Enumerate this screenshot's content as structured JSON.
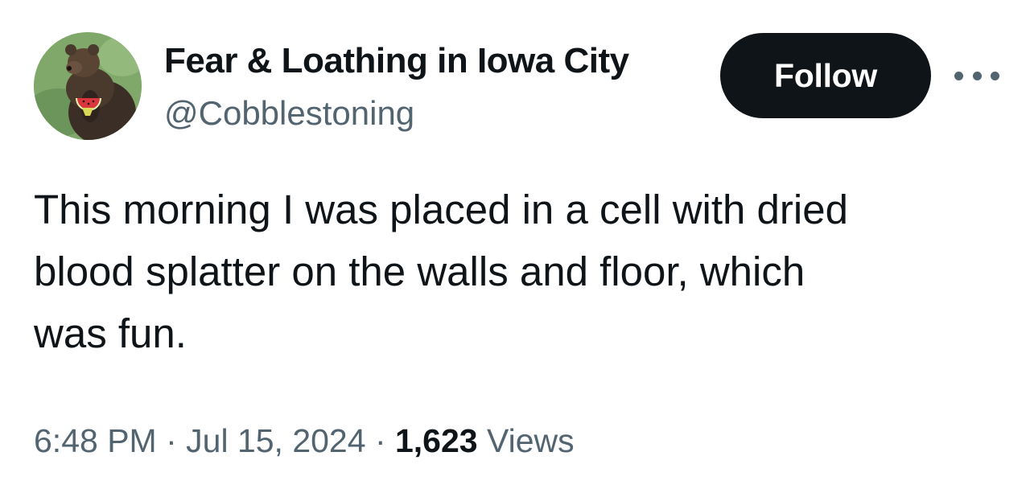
{
  "author": {
    "display_name": "Fear & Loathing in Iowa City",
    "handle": "@Cobblestoning",
    "avatar_icon": "bear-with-watermelon-avatar"
  },
  "actions": {
    "follow_label": "Follow",
    "more_icon": "more-horizontal-icon"
  },
  "tweet": {
    "text": "This morning I was placed in a cell with dried\nblood splatter on the walls and floor, which\nwas fun.",
    "time": "6:48 PM",
    "separator": " · ",
    "date": "Jul 15, 2024",
    "views_count": "1,623",
    "views_label": " Views"
  },
  "colors": {
    "text_primary": "#0f1419",
    "text_secondary": "#536471",
    "button_bg": "#0f1419",
    "button_text": "#ffffff"
  }
}
